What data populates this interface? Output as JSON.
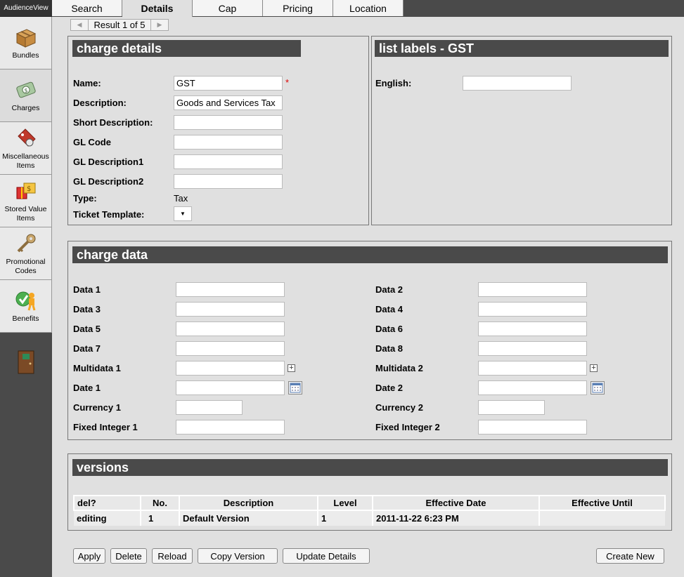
{
  "app": {
    "title": "AudienceView"
  },
  "sidebar": {
    "items": [
      {
        "label": "Bundles"
      },
      {
        "label": "Charges"
      },
      {
        "label": "Miscellaneous Items"
      },
      {
        "label": "Stored Value Items"
      },
      {
        "label": "Promotional Codes"
      },
      {
        "label": "Benefits"
      }
    ]
  },
  "tabs": [
    {
      "label": "Search"
    },
    {
      "label": "Details"
    },
    {
      "label": "Cap"
    },
    {
      "label": "Pricing"
    },
    {
      "label": "Location"
    }
  ],
  "pager": {
    "text": "Result 1 of 5"
  },
  "charge_details": {
    "title": "charge details",
    "name_label": "Name:",
    "name_value": "GST",
    "required_mark": "*",
    "description_label": "Description:",
    "description_value": "Goods and Services Tax",
    "short_description_label": "Short Description:",
    "gl_code_label": "GL Code",
    "gl_description1_label": "GL Description1",
    "gl_description2_label": "GL Description2",
    "type_label": "Type:",
    "type_value": "Tax",
    "ticket_template_label": "Ticket Template:"
  },
  "list_labels": {
    "title": "list labels - GST",
    "english_label": "English:"
  },
  "charge_data": {
    "title": "charge data",
    "left": [
      "Data 1",
      "Data 3",
      "Data 5",
      "Data 7",
      "Multidata 1",
      "Date 1",
      "Currency 1",
      "Fixed Integer 1"
    ],
    "right": [
      "Data 2",
      "Data 4",
      "Data 6",
      "Data 8",
      "Multidata 2",
      "Date 2",
      "Currency 2",
      "Fixed Integer 2"
    ]
  },
  "versions": {
    "title": "versions",
    "columns": [
      "del?",
      "No.",
      "Description",
      "Level",
      "Effective Date",
      "Effective Until"
    ],
    "rows": [
      [
        "editing",
        "1",
        "Default Version",
        "1",
        "2011-11-22 6:23 PM",
        ""
      ]
    ]
  },
  "buttons": {
    "apply": "Apply",
    "delete": "Delete",
    "reload": "Reload",
    "copy_version": "Copy Version",
    "update_details": "Update Details",
    "create_new": "Create New"
  }
}
